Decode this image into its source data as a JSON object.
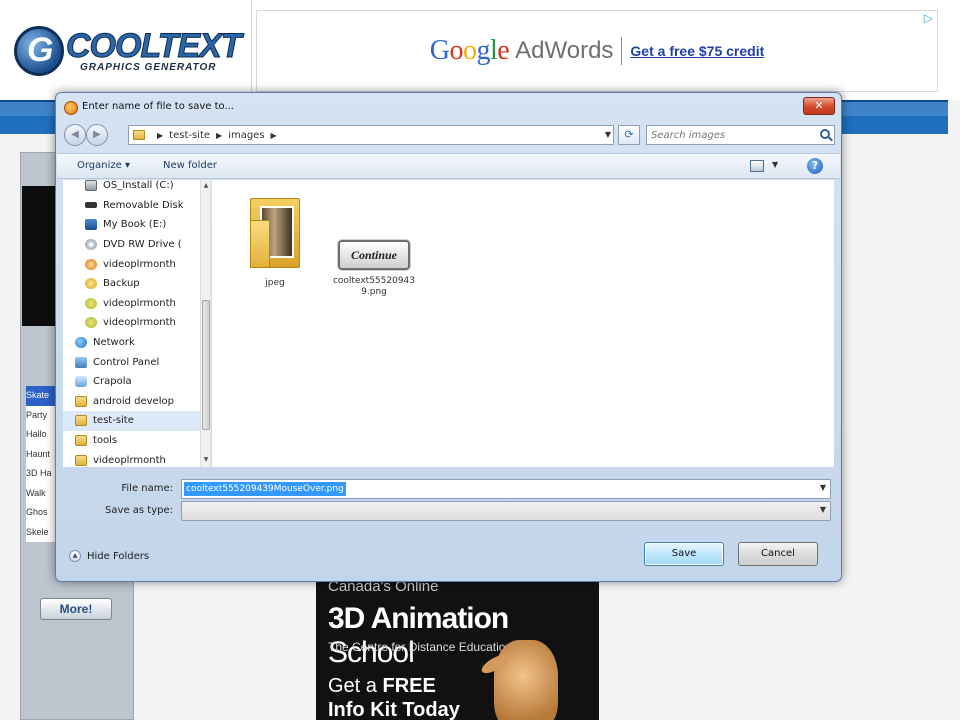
{
  "site": {
    "logo_title": "COOLTEXT",
    "logo_subtitle": "GRAPHICS GENERATOR",
    "ad": {
      "brand": [
        "G",
        "o",
        "o",
        "g",
        "l",
        "e"
      ],
      "product": "AdWords",
      "link": "Get a free $75 credit"
    },
    "sidebar_items": [
      "Skate",
      "Party",
      "Hallo",
      "Haunt",
      "3D Ha",
      "Walk",
      "Ghos",
      "Skele"
    ],
    "sidebar_active_index": 0,
    "more_button": "More!",
    "school_ad": {
      "pre": "Canada's Online",
      "title_bold": "3D Animation",
      "title_light": " School",
      "sub": "The Centre for Distance Education",
      "get": "Get a ",
      "free": "FREE",
      "info": "Info Kit Today"
    }
  },
  "dialog": {
    "title": "Enter name of file to save to...",
    "close_label": "✕",
    "breadcrumb": [
      "test-site",
      "images"
    ],
    "search_placeholder": "Search images",
    "toolbar": {
      "organize": "Organize ▾",
      "new_folder": "New folder"
    },
    "nav_items": [
      {
        "label": "OS_Install (C:)",
        "icon": "drive"
      },
      {
        "label": "Removable Disk",
        "icon": "usb"
      },
      {
        "label": "My Book (E:)",
        "icon": "mybook"
      },
      {
        "label": "DVD RW Drive (",
        "icon": "dvd"
      },
      {
        "label": "videoplrmonth",
        "icon": "video"
      },
      {
        "label": "Backup",
        "icon": "backup"
      },
      {
        "label": "videoplrmonth",
        "icon": "video2"
      },
      {
        "label": "videoplrmonth",
        "icon": "video2"
      },
      {
        "label": "Network",
        "icon": "network"
      },
      {
        "label": "Control Panel",
        "icon": "cpanel"
      },
      {
        "label": "Crapola",
        "icon": "recycle"
      },
      {
        "label": "android develop",
        "icon": "folder"
      },
      {
        "label": "test-site",
        "icon": "folder"
      },
      {
        "label": "tools",
        "icon": "folder"
      },
      {
        "label": "videoplrmonth",
        "icon": "folder"
      }
    ],
    "nav_active_index": 12,
    "files": [
      {
        "name": "jpeg",
        "type": "folder"
      },
      {
        "name": "cooltext55520943 9.png",
        "type": "image",
        "preview_text": "Continue"
      }
    ],
    "file_name_label": "File name:",
    "file_name_value": "cooltext555209439MouseOver.png",
    "save_type_label": "Save as type:",
    "save_type_value": "",
    "hide_folders": "Hide Folders",
    "save_button": "Save",
    "cancel_button": "Cancel"
  },
  "colors": {
    "nav_blue": "#1f6fbf",
    "dialog_frame": "#c3d5ea",
    "selection": "#3399ff"
  }
}
